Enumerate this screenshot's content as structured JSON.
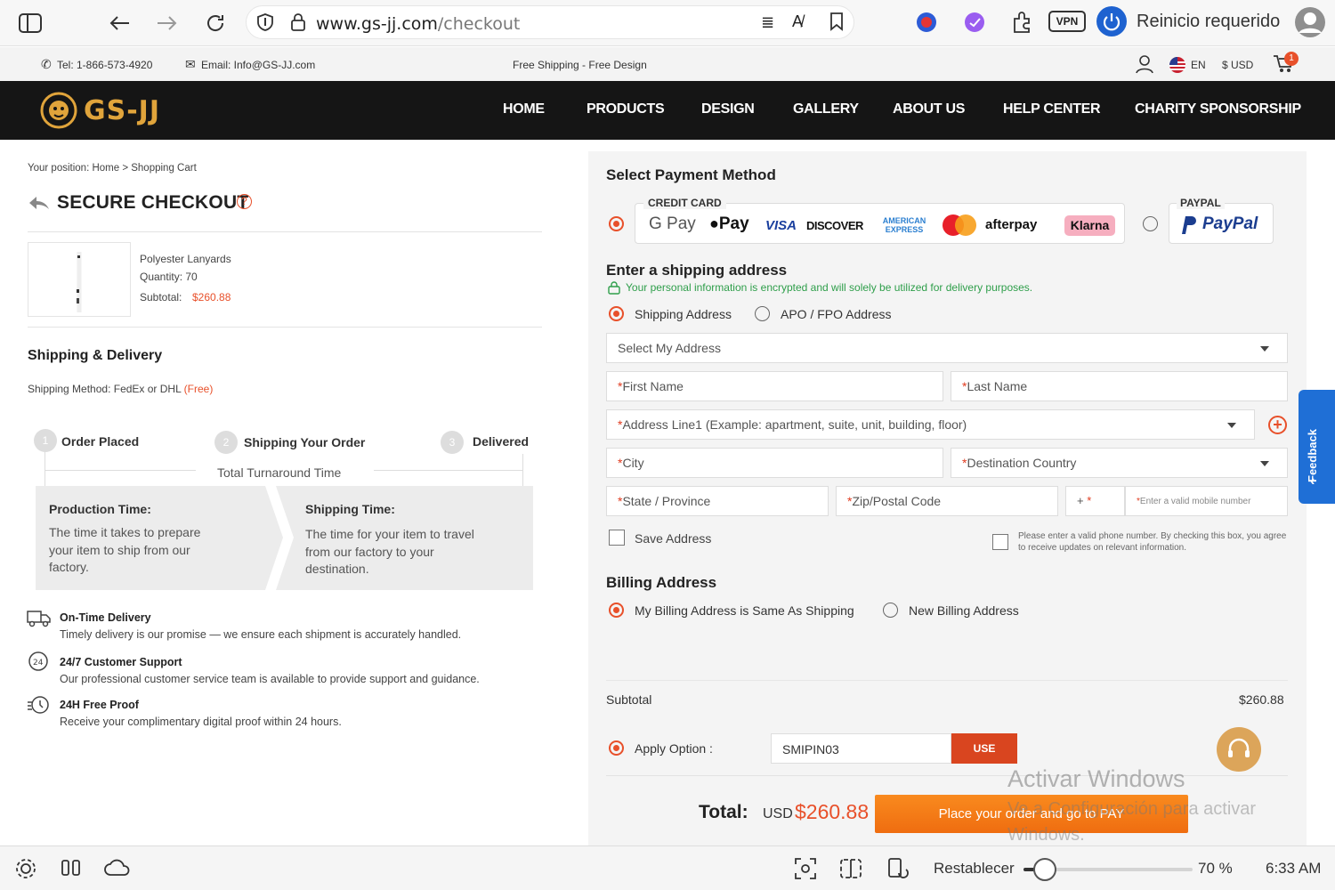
{
  "browser": {
    "url_domain": "www.gs-jj.com",
    "url_path": "/checkout",
    "restart_label": "Reinicio requerido",
    "vpn_label": "VPN"
  },
  "topinfo": {
    "tel": "Tel: 1-866-573-4920",
    "email": "Email: Info@GS-JJ.com",
    "promo": "Free Shipping - Free Design",
    "lang": "EN",
    "currency": "$ USD",
    "cart_count": "1"
  },
  "nav": {
    "logo": "GS-JJ",
    "items": [
      "HOME",
      "PRODUCTS",
      "DESIGN",
      "GALLERY",
      "ABOUT US",
      "HELP CENTER",
      "CHARITY SPONSORSHIP"
    ]
  },
  "left": {
    "breadcrumb": "Your position: Home > Shopping Cart",
    "title": "SECURE CHECKOUT",
    "product": {
      "name": "Polyester Lanyards",
      "quantity": "Quantity:  70",
      "subtotal_label": "Subtotal:",
      "subtotal_value": "$260.88"
    },
    "shipping_title": "Shipping & Delivery",
    "shipping_method_label": "Shipping Method: FedEx or DHL",
    "shipping_free": "(Free)",
    "steps": [
      {
        "num": "1",
        "label": "Order Placed"
      },
      {
        "num": "2",
        "label": "Shipping Your Order"
      },
      {
        "num": "3",
        "label": "Delivered"
      }
    ],
    "turnaround": "Total Turnaround Time",
    "production_title": "Production Time:",
    "production_desc": "The time it takes to prepare your item to ship from our factory.",
    "shipping_time_title": "Shipping Time:",
    "shipping_time_desc": "The time for your item to travel from our factory to your destination.",
    "features": [
      {
        "title": "On-Time Delivery",
        "desc": "Timely delivery is our promise — we ensure each shipment is accurately handled."
      },
      {
        "title": "24/7 Customer Support",
        "desc": "Our professional customer service team is available to provide support and guidance."
      },
      {
        "title": "24H Free Proof",
        "desc": "Receive your complimentary digital proof within 24 hours."
      }
    ]
  },
  "payment": {
    "title": "Select Payment Method",
    "credit_card_label": "CREDIT CARD",
    "cards": [
      "G Pay",
      "Pay",
      "VISA",
      "DISCOVER",
      "AMERICAN EXPRESS",
      "afterpay",
      "Klarna"
    ],
    "paypal_label": "PAYPAL",
    "paypal_logo": "PayPal"
  },
  "shipping_address": {
    "title": "Enter a shipping address",
    "secure_note": "Your personal information is encrypted and will solely be utilized for delivery purposes.",
    "option_shipping": "Shipping Address",
    "option_apo": "APO / FPO Address",
    "select_address": "Select My Address",
    "first_name": "First Name",
    "last_name": "Last Name",
    "address1": "Address Line1 (Example: apartment, suite, unit, building, floor)",
    "city": "City",
    "country": "Destination Country",
    "state": "State / Province",
    "zip": "Zip/Postal Code",
    "phone_code": "+",
    "phone_placeholder": "Enter a valid mobile number",
    "save_address": "Save Address",
    "phone_note": "Please enter a valid phone number. By checking this box, you agree to receive updates on relevant information."
  },
  "billing": {
    "title": "Billing Address",
    "same": "My Billing Address is Same As Shipping",
    "new": "New Billing Address"
  },
  "summary": {
    "subtotal_label": "Subtotal",
    "subtotal_value": "$260.88",
    "apply_option": "Apply Option :",
    "coupon_value": "SMIPIN03",
    "use_button": "USE",
    "total_label": "Total:",
    "total_currency": "USD",
    "total_value": "$260.88",
    "place_order": "Place your order and go to PAY"
  },
  "feedback_tab": "Feedback",
  "watermark": {
    "line1": "Activar Windows",
    "line2": "Ve a Configuración para activar",
    "line3": "Windows."
  },
  "taskbar": {
    "restore": "Restablecer",
    "zoom": "70 %",
    "zoom_level": 0.07,
    "time": "6:33 AM"
  },
  "colors": {
    "accent": "#e8502a",
    "nav_bg": "#151515",
    "logo_gold": "#e0a43b",
    "green": "#2e9e4a",
    "order_button": "#f47b16"
  }
}
